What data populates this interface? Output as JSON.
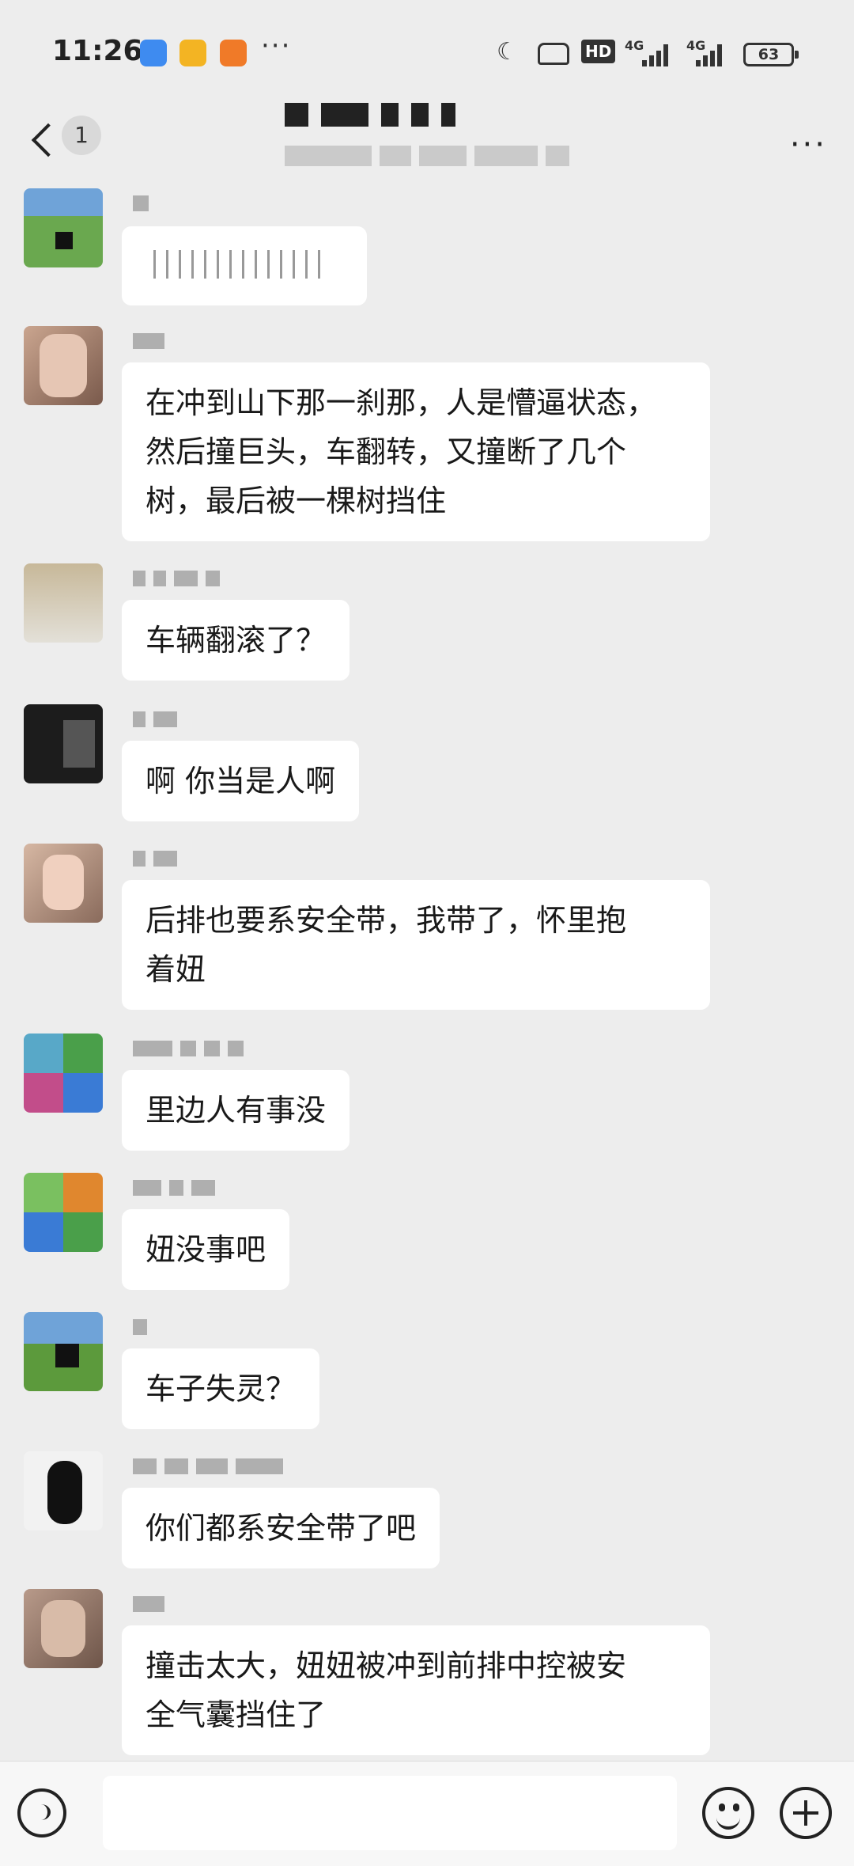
{
  "status_bar": {
    "time": "11:26",
    "more": "···",
    "hd": "HD",
    "net1": "4G",
    "net2": "4G",
    "battery": "63"
  },
  "header": {
    "unread_count": "1",
    "more": "···"
  },
  "messages": [
    {
      "text": ""
    },
    {
      "text": "在冲到山下那一刹那，人是懵逼状态，\n然后撞巨头，车翻转，又撞断了几个\n树，最后被一棵树挡住"
    },
    {
      "text": "车辆翻滚了？"
    },
    {
      "text": "啊 你当是人啊"
    },
    {
      "text": "后排也要系安全带，我带了，怀里抱\n着妞"
    },
    {
      "text": "里边人有事没"
    },
    {
      "text": "妞没事吧"
    },
    {
      "text": "车子失灵？"
    },
    {
      "text": "你们都系安全带了吧"
    },
    {
      "text": "撞击太大，妞妞被冲到前排中控被安\n全气囊挡住了"
    }
  ]
}
